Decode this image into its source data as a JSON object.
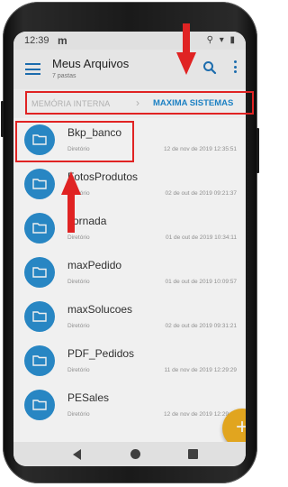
{
  "status_bar": {
    "time": "12:39",
    "notification": "m",
    "icons": "⚲ ▾ ▮"
  },
  "app_bar": {
    "title": "Meus Arquivos",
    "subtitle": "7 pastas",
    "menu_icon": "hamburger-menu-icon",
    "search_icon": "search-icon",
    "more_icon": "more-vert-icon"
  },
  "breadcrumb": {
    "items": [
      {
        "label": "MEMÓRIA INTERNA",
        "active": false
      },
      {
        "label": "MAXIMA SISTEMAS",
        "active": true
      }
    ],
    "separator": "›"
  },
  "files": [
    {
      "name": "Bkp_banco",
      "type": "Diretório",
      "date": "12 de nov de 2019 12:35:51",
      "highlighted": true
    },
    {
      "name": "FotosProdutos",
      "type": "Diretório",
      "date": "02 de out de 2019 09:21:37",
      "highlighted": false
    },
    {
      "name": "Jornada",
      "type": "Diretório",
      "date": "01 de out de 2019 10:34:11",
      "highlighted": false
    },
    {
      "name": "maxPedido",
      "type": "Diretório",
      "date": "01 de out de 2019 10:09:57",
      "highlighted": false
    },
    {
      "name": "maxSolucoes",
      "type": "Diretório",
      "date": "02 de out de 2019 09:31:21",
      "highlighted": false
    },
    {
      "name": "PDF_Pedidos",
      "type": "Diretório",
      "date": "11 de nov de 2019 12:29:29",
      "highlighted": false
    },
    {
      "name": "PESales",
      "type": "Diretório",
      "date": "12 de nov de 2019 12:29:20",
      "highlighted": false
    }
  ],
  "fab": {
    "label": "+",
    "icon": "add-icon"
  },
  "colors": {
    "accent": "#1f8ad0",
    "folder": "#2b8fd0",
    "fab": "#f0b021",
    "annotation": "#e02323"
  }
}
